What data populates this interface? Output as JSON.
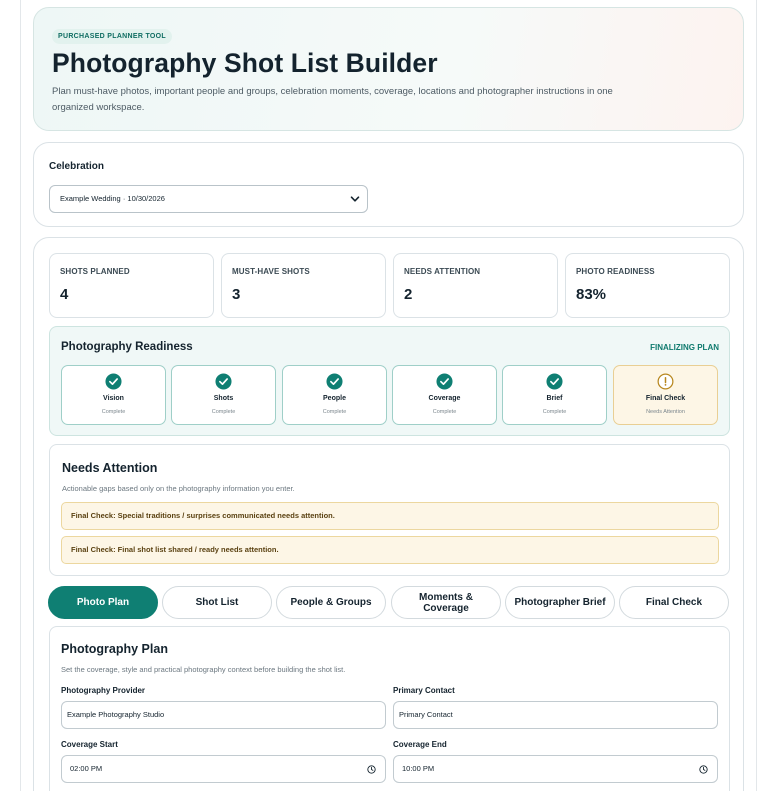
{
  "hero": {
    "badge": "PURCHASED PLANNER TOOL",
    "title": "Photography Shot List Builder",
    "description": "Plan must-have photos, important people and groups, celebration moments, coverage, locations and photographer instructions in one organized workspace."
  },
  "celebration": {
    "label": "Celebration",
    "selected": "Example Wedding · 10/30/2026"
  },
  "stats": [
    {
      "label": "SHOTS PLANNED",
      "value": "4"
    },
    {
      "label": "MUST-HAVE SHOTS",
      "value": "3"
    },
    {
      "label": "NEEDS ATTENTION",
      "value": "2"
    },
    {
      "label": "PHOTO READINESS",
      "value": "83%"
    }
  ],
  "readiness": {
    "title": "Photography Readiness",
    "status": "FINALIZING PLAN",
    "steps": [
      {
        "name": "Vision",
        "status": "Complete",
        "icon": "check-circle-icon"
      },
      {
        "name": "Shots",
        "status": "Complete",
        "icon": "check-circle-icon"
      },
      {
        "name": "People",
        "status": "Complete",
        "icon": "check-circle-icon"
      },
      {
        "name": "Coverage",
        "status": "Complete",
        "icon": "check-circle-icon"
      },
      {
        "name": "Brief",
        "status": "Complete",
        "icon": "check-circle-icon"
      },
      {
        "name": "Final Check",
        "status": "Needs Attention",
        "icon": "alert-circle-icon"
      }
    ]
  },
  "attention": {
    "title": "Needs Attention",
    "description": "Actionable gaps based only on the photography information you enter.",
    "items": [
      "Final Check: Special traditions / surprises communicated needs attention.",
      "Final Check: Final shot list shared / ready needs attention."
    ]
  },
  "tabs": [
    {
      "label": "Photo Plan"
    },
    {
      "label": "Shot List"
    },
    {
      "label": "People & Groups"
    },
    {
      "label": "Moments & Coverage"
    },
    {
      "label": "Photographer Brief"
    },
    {
      "label": "Final Check"
    }
  ],
  "plan": {
    "title": "Photography Plan",
    "description": "Set the coverage, style and practical photography context before building the shot list.",
    "provider_label": "Photography Provider",
    "provider_value": "Example Photography Studio",
    "contact_label": "Primary Contact",
    "contact_value": "Primary Contact",
    "start_label": "Coverage Start",
    "start_value": "02:00 PM",
    "end_label": "Coverage End",
    "end_value": "10:00 PM"
  },
  "colors": {
    "accent": "#0f7f73",
    "warning_bg": "#fdf6e6",
    "warning_text": "#5b4212"
  }
}
